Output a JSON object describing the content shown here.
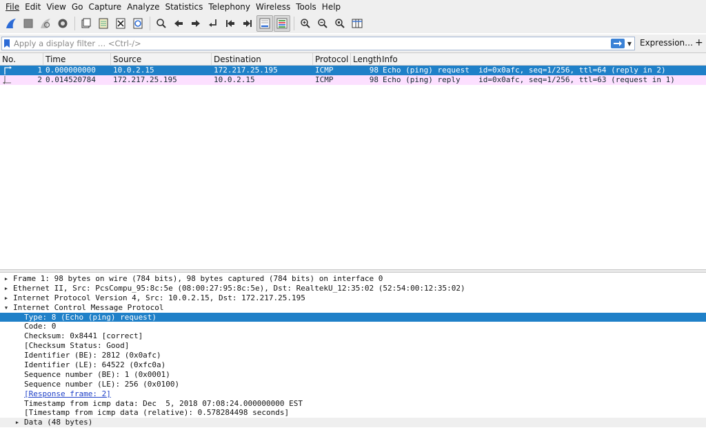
{
  "menu": [
    "File",
    "Edit",
    "View",
    "Go",
    "Capture",
    "Analyze",
    "Statistics",
    "Telephony",
    "Wireless",
    "Tools",
    "Help"
  ],
  "toolbar": {
    "icons": [
      "shark-fin-start-icon",
      "stop-square-icon",
      "shark-fin-restart-icon",
      "capture-options-gear-icon",
      "open-folder-icon",
      "save-file-icon",
      "close-file-icon",
      "reload-icon",
      "search-icon",
      "back-arrow-icon",
      "forward-arrow-icon",
      "goto-packet-icon",
      "first-packet-icon",
      "last-packet-icon",
      "autoscroll-icon",
      "colorize-icon",
      "zoom-in-icon",
      "zoom-out-icon",
      "zoom-normal-icon",
      "resize-columns-icon"
    ]
  },
  "filter": {
    "placeholder": "Apply a display filter … <Ctrl-/>",
    "expression_label": "Expression…",
    "plus_label": "+"
  },
  "packet_list": {
    "columns": [
      "No.",
      "Time",
      "Source",
      "Destination",
      "Protocol",
      "Length",
      "Info"
    ],
    "rows": [
      {
        "no": "1",
        "time": "0.000000000",
        "source": "10.0.2.15",
        "destination": "172.217.25.195",
        "protocol": "ICMP",
        "length": "98",
        "info": "Echo (ping) request  id=0x0afc, seq=1/256, ttl=64 (reply in 2)"
      },
      {
        "no": "2",
        "time": "0.014520784",
        "source": "172.217.25.195",
        "destination": "10.0.2.15",
        "protocol": "ICMP",
        "length": "98",
        "info": "Echo (ping) reply    id=0x0afc, seq=1/256, ttl=63 (request in 1)"
      }
    ]
  },
  "details": {
    "frame": "Frame 1: 98 bytes on wire (784 bits), 98 bytes captured (784 bits) on interface 0",
    "ethernet": "Ethernet II, Src: PcsCompu_95:8c:5e (08:00:27:95:8c:5e), Dst: RealtekU_12:35:02 (52:54:00:12:35:02)",
    "ip": "Internet Protocol Version 4, Src: 10.0.2.15, Dst: 172.217.25.195",
    "icmp": "Internet Control Message Protocol",
    "icmp_fields": {
      "type": "Type: 8 (Echo (ping) request)",
      "code": "Code: 0",
      "checksum": "Checksum: 0x8441 [correct]",
      "checksum_status": "[Checksum Status: Good]",
      "identifier_be": "Identifier (BE): 2812 (0x0afc)",
      "identifier_le": "Identifier (LE): 64522 (0xfc0a)",
      "seq_be": "Sequence number (BE): 1 (0x0001)",
      "seq_le": "Sequence number (LE): 256 (0x0100)",
      "response_frame": "[Response frame: 2]",
      "timestamp": "Timestamp from icmp data: Dec  5, 2018 07:08:24.000000000 EST",
      "timestamp_rel": "[Timestamp from icmp data (relative): 0.578284498 seconds]",
      "data": "Data (48 bytes)"
    }
  },
  "colors": {
    "selection": "#1f80c8",
    "icmp_row": "#fce0ff",
    "chrome": "#efefef"
  }
}
